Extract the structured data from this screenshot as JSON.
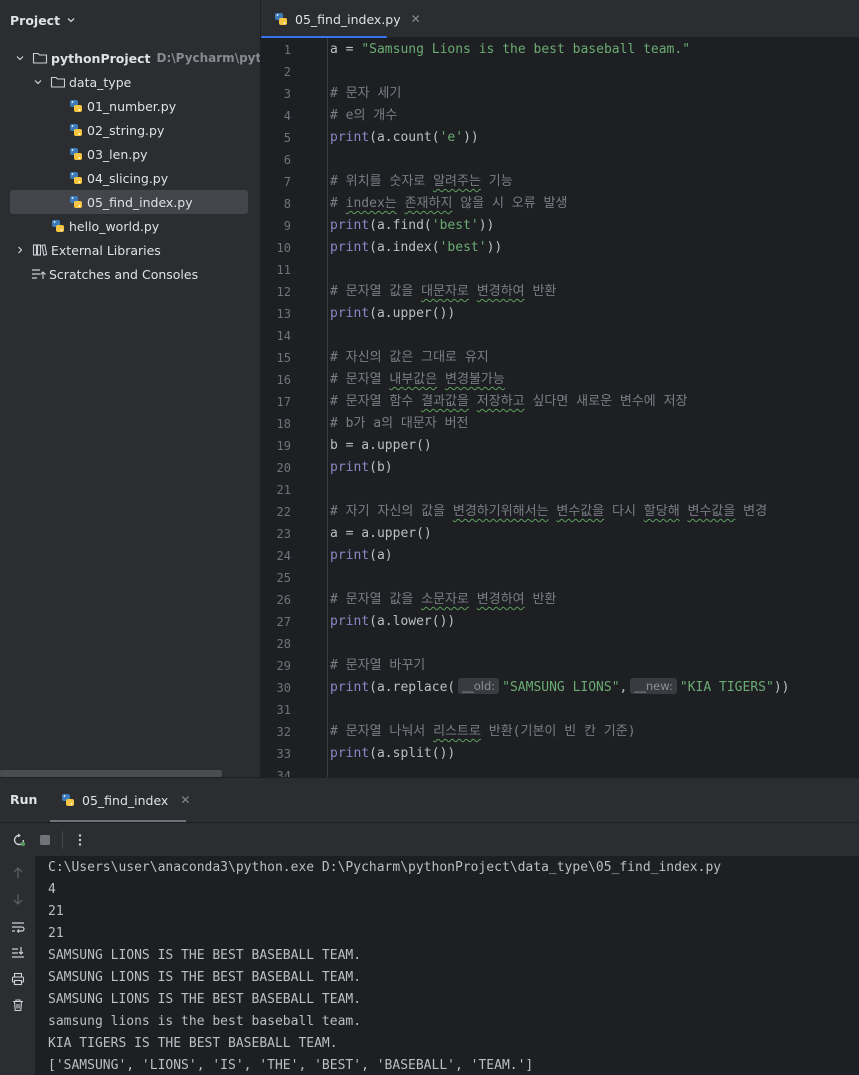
{
  "project_panel": {
    "title": "Project",
    "tree": [
      {
        "label": "pythonProject",
        "hint": "D:\\Pycharm\\pythonProject",
        "type": "folder-open",
        "expanded": true
      },
      {
        "label": "data_type",
        "type": "folder-open",
        "expanded": true
      },
      {
        "label": "01_number.py",
        "type": "python-file"
      },
      {
        "label": "02_string.py",
        "type": "python-file"
      },
      {
        "label": "03_len.py",
        "type": "python-file"
      },
      {
        "label": "04_slicing.py",
        "type": "python-file"
      },
      {
        "label": "05_find_index.py",
        "type": "python-file",
        "selected": true
      },
      {
        "label": "hello_world.py",
        "type": "python-file"
      },
      {
        "label": "External Libraries",
        "type": "library",
        "expanded": false
      },
      {
        "label": "Scratches and Consoles",
        "type": "scratches"
      }
    ]
  },
  "editor": {
    "tab_label": "05_find_index.py",
    "lines": [
      [
        {
          "t": "a = ",
          "c": ""
        },
        {
          "t": "\"Samsung Lions is the best baseball team.\"",
          "c": "str"
        }
      ],
      [],
      [
        {
          "t": "# 문자 세기",
          "c": "cm"
        }
      ],
      [
        {
          "t": "# e의 개수",
          "c": "cm"
        }
      ],
      [
        {
          "t": "print",
          "c": "fn"
        },
        {
          "t": "(a.count(",
          "c": ""
        },
        {
          "t": "'e'",
          "c": "str"
        },
        {
          "t": "))",
          "c": ""
        }
      ],
      [],
      [
        {
          "t": "# 위치를 숫자로 ",
          "c": "cm"
        },
        {
          "t": "알려주는",
          "c": "cm wavy"
        },
        {
          "t": " 기능",
          "c": "cm"
        }
      ],
      [
        {
          "t": "# ",
          "c": "cm"
        },
        {
          "t": "index는",
          "c": "cm wavy"
        },
        {
          "t": " ",
          "c": "cm"
        },
        {
          "t": "존재하지",
          "c": "cm wavy"
        },
        {
          "t": " 않을 시 오류 발생",
          "c": "cm"
        }
      ],
      [
        {
          "t": "print",
          "c": "fn"
        },
        {
          "t": "(a.find(",
          "c": ""
        },
        {
          "t": "'best'",
          "c": "str"
        },
        {
          "t": "))",
          "c": ""
        }
      ],
      [
        {
          "t": "print",
          "c": "fn"
        },
        {
          "t": "(a.index(",
          "c": ""
        },
        {
          "t": "'best'",
          "c": "str"
        },
        {
          "t": "))",
          "c": ""
        }
      ],
      [],
      [
        {
          "t": "# 문자열 값을 ",
          "c": "cm"
        },
        {
          "t": "대문자로",
          "c": "cm wavy"
        },
        {
          "t": " ",
          "c": "cm"
        },
        {
          "t": "변경하여",
          "c": "cm wavy"
        },
        {
          "t": " 반환",
          "c": "cm"
        }
      ],
      [
        {
          "t": "print",
          "c": "fn"
        },
        {
          "t": "(a.upper())",
          "c": ""
        }
      ],
      [],
      [
        {
          "t": "# 자신의 값은 그대로 유지",
          "c": "cm"
        }
      ],
      [
        {
          "t": "# 문자열 ",
          "c": "cm"
        },
        {
          "t": "내부값은",
          "c": "cm wavy"
        },
        {
          "t": " ",
          "c": "cm"
        },
        {
          "t": "변경불가능",
          "c": "cm wavy"
        }
      ],
      [
        {
          "t": "# 문자열 함수 ",
          "c": "cm"
        },
        {
          "t": "결과값을",
          "c": "cm wavy"
        },
        {
          "t": " ",
          "c": "cm"
        },
        {
          "t": "저장하고",
          "c": "cm wavy"
        },
        {
          "t": " 싶다면 새로운 변수에 저장",
          "c": "cm"
        }
      ],
      [
        {
          "t": "# b가 a의 대문자 버전",
          "c": "cm"
        }
      ],
      [
        {
          "t": "b = a.upper()",
          "c": ""
        }
      ],
      [
        {
          "t": "print",
          "c": "fn"
        },
        {
          "t": "(b)",
          "c": ""
        }
      ],
      [],
      [
        {
          "t": "# 자기 자신의 값을 ",
          "c": "cm"
        },
        {
          "t": "변경하기위해서는",
          "c": "cm wavy"
        },
        {
          "t": " ",
          "c": "cm"
        },
        {
          "t": "변수값을",
          "c": "cm wavy"
        },
        {
          "t": " 다시 ",
          "c": "cm"
        },
        {
          "t": "할당해",
          "c": "cm wavy"
        },
        {
          "t": " ",
          "c": "cm"
        },
        {
          "t": "변수값을",
          "c": "cm wavy"
        },
        {
          "t": " 변경",
          "c": "cm"
        }
      ],
      [
        {
          "t": "a = a.upper()",
          "c": ""
        }
      ],
      [
        {
          "t": "print",
          "c": "fn"
        },
        {
          "t": "(a)",
          "c": ""
        }
      ],
      [],
      [
        {
          "t": "# 문자열 값을 ",
          "c": "cm"
        },
        {
          "t": "소문자로",
          "c": "cm wavy"
        },
        {
          "t": " ",
          "c": "cm"
        },
        {
          "t": "변경하여",
          "c": "cm wavy"
        },
        {
          "t": " 반환",
          "c": "cm"
        }
      ],
      [
        {
          "t": "print",
          "c": "fn"
        },
        {
          "t": "(a.lower())",
          "c": ""
        }
      ],
      [],
      [
        {
          "t": "# 문자열 바꾸기",
          "c": "cm"
        }
      ],
      [
        {
          "t": "print",
          "c": "fn"
        },
        {
          "t": "(a.replace(",
          "c": ""
        },
        {
          "t": "__old:",
          "c": "inlay"
        },
        {
          "t": "\"SAMSUNG LIONS\"",
          "c": "str"
        },
        {
          "t": ",",
          "c": ""
        },
        {
          "t": "__new:",
          "c": "inlay"
        },
        {
          "t": "\"KIA TIGERS\"",
          "c": "str"
        },
        {
          "t": "))",
          "c": ""
        }
      ],
      [],
      [
        {
          "t": "# 문자열 나눠서 ",
          "c": "cm"
        },
        {
          "t": "리스트로",
          "c": "cm wavy"
        },
        {
          "t": " 반환(기본이 빈 칸 기준)",
          "c": "cm"
        }
      ],
      [
        {
          "t": "print",
          "c": "fn"
        },
        {
          "t": "(a.split())",
          "c": ""
        }
      ],
      []
    ]
  },
  "run_panel": {
    "title": "Run",
    "tab_label": "05_find_index",
    "output": [
      "C:\\Users\\user\\anaconda3\\python.exe D:\\Pycharm\\pythonProject\\data_type\\05_find_index.py",
      "4",
      "21",
      "21",
      "SAMSUNG LIONS IS THE BEST BASEBALL TEAM.",
      "SAMSUNG LIONS IS THE BEST BASEBALL TEAM.",
      "SAMSUNG LIONS IS THE BEST BASEBALL TEAM.",
      "samsung lions is the best baseball team.",
      "KIA TIGERS IS THE BEST BASEBALL TEAM.",
      "['SAMSUNG', 'LIONS', 'IS', 'THE', 'BEST', 'BASEBALL', 'TEAM.']"
    ]
  },
  "icons": {
    "python_file": "python-file-icon",
    "folder": "folder-icon",
    "library": "library-icon",
    "scratches": "scratches-icon",
    "rerun": "rerun-icon",
    "stop": "stop-icon",
    "more": "more-vertical-icon",
    "up": "arrow-up-icon",
    "down": "arrow-down-icon",
    "soft_wrap": "soft-wrap-icon",
    "scroll_end": "scroll-to-end-icon",
    "print": "print-icon",
    "trash": "trash-icon"
  },
  "colors": {
    "accent": "#3574f0",
    "string": "#6aab73",
    "comment": "#7a7e85",
    "builtin": "#8888c6",
    "python_blue": "#3d7ab8",
    "python_yellow": "#f5c543"
  }
}
